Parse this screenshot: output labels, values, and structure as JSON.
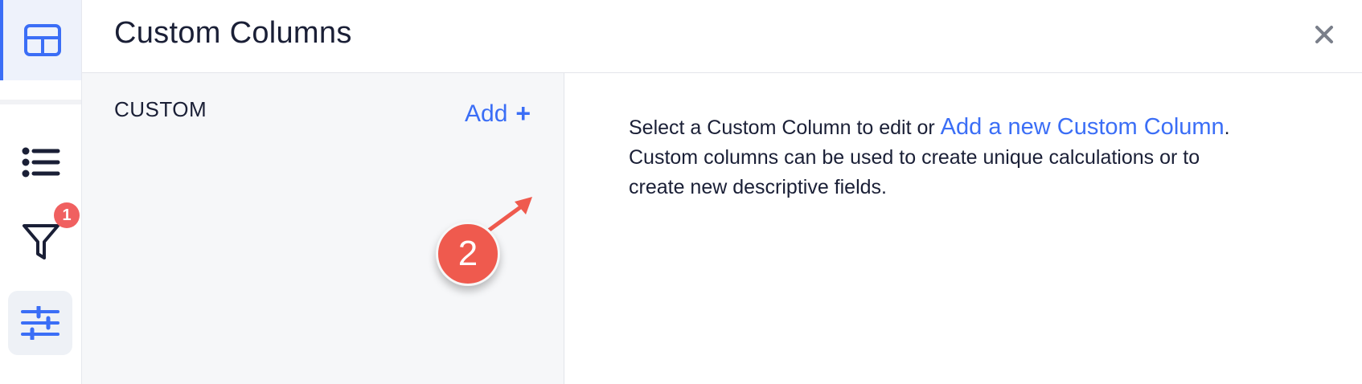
{
  "header": {
    "title": "Custom Columns",
    "close_icon": "close-icon"
  },
  "rail": {
    "items": [
      {
        "name": "table-icon",
        "active": true
      },
      {
        "name": "list-icon",
        "active": false
      },
      {
        "name": "filter-icon",
        "active": false,
        "badge": "1"
      },
      {
        "name": "sliders-icon",
        "active": false
      }
    ]
  },
  "panel": {
    "section_label": "CUSTOM",
    "add_label": "Add",
    "add_plus": "+"
  },
  "annotation": {
    "step": "2"
  },
  "content": {
    "text_before_link": "Select a Custom Column to edit or ",
    "link_text": "Add a new Custom Column",
    "text_after_link": ".",
    "line2": "Custom columns can be used to create unique calculations or to",
    "line3": "create new descriptive fields."
  },
  "colors": {
    "accent": "#3b6ef6",
    "badge": "#f06060",
    "annotation": "#ef5a4e",
    "panel_bg": "#f6f7f9"
  }
}
